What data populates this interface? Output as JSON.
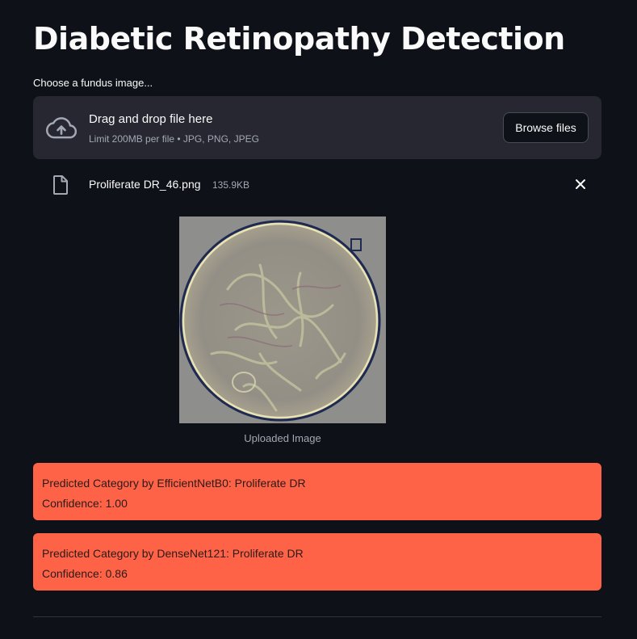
{
  "page": {
    "title": "Diabetic Retinopathy Detection"
  },
  "uploader": {
    "label": "Choose a fundus image...",
    "drop_text": "Drag and drop file here",
    "limit_text": "Limit 200MB per file • JPG, PNG, JPEG",
    "browse_label": "Browse files",
    "icon": "cloud-upload-icon"
  },
  "uploaded_file": {
    "name": "Proliferate DR_46.png",
    "size": "135.9KB",
    "icon": "file-icon"
  },
  "image": {
    "caption": "Uploaded Image"
  },
  "results": [
    {
      "line1": "Predicted Category by EfficientNetB0: Proliferate DR",
      "line2": "Confidence: 1.00"
    },
    {
      "line1": "Predicted Category by DenseNet121: Proliferate DR",
      "line2": "Confidence: 0.86"
    }
  ],
  "colors": {
    "background": "#0e1117",
    "dropzone": "#262730",
    "alert": "#ff6347",
    "muted_text": "#a3a8b4"
  }
}
